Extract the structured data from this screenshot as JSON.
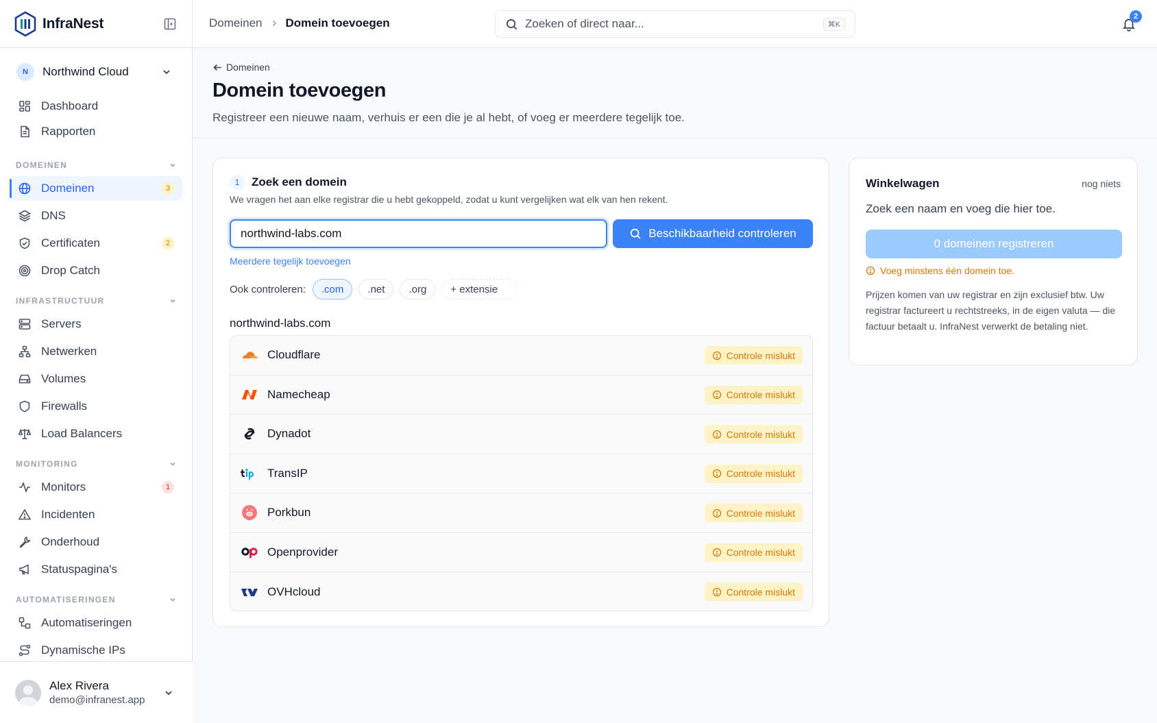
{
  "brand": {
    "name": "InfraNest"
  },
  "org": {
    "initial": "N",
    "name": "Northwind Cloud"
  },
  "nav": {
    "dashboard": "Dashboard",
    "rapporten": "Rapporten",
    "section_domeinen": "DOMEINEN",
    "domeinen": "Domeinen",
    "domeinen_badge": "3",
    "dns": "DNS",
    "certificaten": "Certificaten",
    "certificaten_badge": "2",
    "dropcatch": "Drop Catch",
    "section_infra": "INFRASTRUCTUUR",
    "servers": "Servers",
    "netwerken": "Netwerken",
    "volumes": "Volumes",
    "firewalls": "Firewalls",
    "loadbalancers": "Load Balancers",
    "section_monitoring": "MONITORING",
    "monitors": "Monitors",
    "monitors_badge": "1",
    "incidenten": "Incidenten",
    "onderhoud": "Onderhoud",
    "statuspaginas": "Statuspagina's",
    "section_auto": "AUTOMATISERINGEN",
    "automatiseringen": "Automatiseringen",
    "dynamische_ips": "Dynamische IPs"
  },
  "user": {
    "name": "Alex Rivera",
    "email": "demo@infranest.app"
  },
  "topbar": {
    "crumb_parent": "Domeinen",
    "crumb_current": "Domein toevoegen",
    "search_placeholder": "Zoeken of direct naar...",
    "search_kbd": "⌘K",
    "notif_count": "2"
  },
  "page": {
    "back_label": "Domeinen",
    "title": "Domein toevoegen",
    "subtitle": "Registreer een nieuwe naam, verhuis er een die je al hebt, of voeg er meerdere tegelijk toe."
  },
  "search_card": {
    "step_number": "1",
    "step_title": "Zoek een domein",
    "step_desc": "We vragen het aan elke registrar die u hebt gekoppeld, zodat u kunt vergelijken wat elk van hen rekent.",
    "input_value": "northwind-labs.com",
    "check_button": "Beschikbaarheid controleren",
    "multi_link": "Meerdere tegelijk toevoegen",
    "also_label": "Ook controleren:",
    "extensions": [
      ".com",
      ".net",
      ".org",
      "+ extensie"
    ],
    "result_domain": "northwind-labs.com",
    "fail_label": "Controle mislukt",
    "registrars": [
      "Cloudflare",
      "Namecheap",
      "Dynadot",
      "TransIP",
      "Porkbun",
      "Openprovider",
      "OVHcloud"
    ]
  },
  "cart": {
    "title": "Winkelwagen",
    "status": "nog niets",
    "empty_text": "Zoek een naam en voeg die hier toe.",
    "register_button": "0 domeinen registreren",
    "warning": "Voeg minstens één domein toe.",
    "note": "Prijzen komen van uw registrar en zijn exclusief btw. Uw registrar factureert u rechtstreeks, in de eigen valuta — die factuur betaalt u. InfraNest verwerkt de betaling niet."
  },
  "colors": {
    "accent": "#3b82f6",
    "warning": "#d97706",
    "warning_bg": "#fef3c7"
  }
}
